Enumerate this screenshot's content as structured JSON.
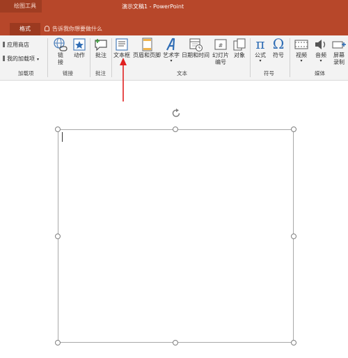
{
  "window": {
    "context_tab": "绘图工具",
    "title": "演示文稿1 - PowerPoint"
  },
  "tabs": {
    "format": "格式",
    "tell_me": "告诉我你想要做什么"
  },
  "ribbon": {
    "addins": {
      "store": "应用商店",
      "my_addins": "我的加载项",
      "group": "加载项"
    },
    "links": {
      "link_line1": "链",
      "link_line2": "接",
      "action": "动作",
      "group": "链接"
    },
    "comments": {
      "comment": "批注",
      "group": "批注"
    },
    "text": {
      "textbox": "文本框",
      "header_footer": "页眉和页脚",
      "wordart": "艺术字",
      "datetime": "日期和时间",
      "slide_number_line1": "幻灯片",
      "slide_number_line2": "编号",
      "object": "对象",
      "group": "文本"
    },
    "symbols": {
      "equation": "公式",
      "symbol": "符号",
      "group": "符号"
    },
    "media": {
      "video": "视频",
      "audio": "音频",
      "screen_line1": "屏幕",
      "screen_line2": "录制",
      "group": "媒体"
    }
  },
  "icons": [
    "store-icon",
    "addins-icon",
    "link-icon",
    "action-icon",
    "comment-icon",
    "textbox-icon",
    "header-footer-icon",
    "wordart-icon",
    "datetime-icon",
    "slide-number-icon",
    "object-icon",
    "pi-icon",
    "omega-icon",
    "video-icon",
    "audio-icon",
    "screen-recording-icon",
    "rotate-handle-icon",
    "arrow-annotation-icon"
  ],
  "colors": {
    "accent": "#b7472a",
    "ribbon_bg": "#f3f3f3",
    "annotation_arrow": "#e02020"
  }
}
